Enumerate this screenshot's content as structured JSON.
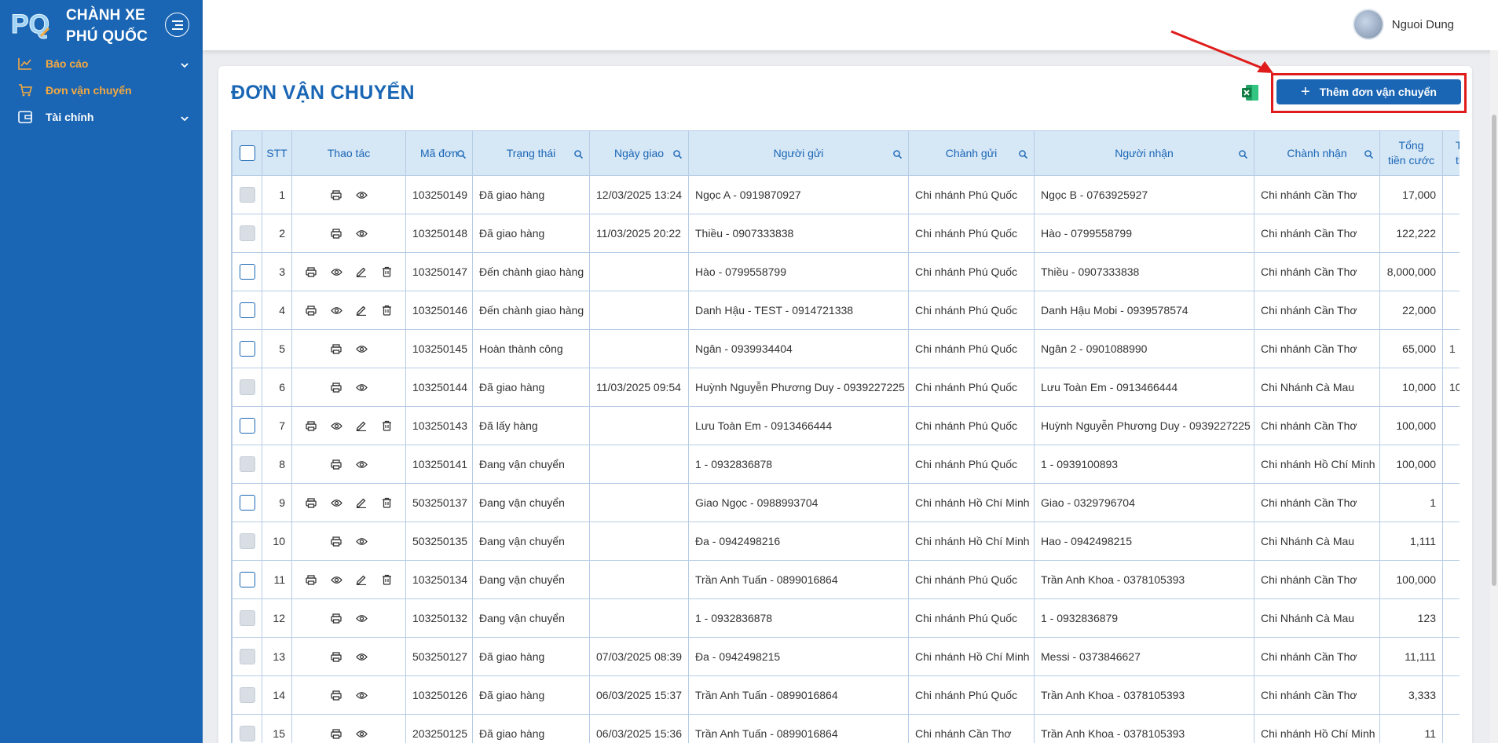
{
  "brand": {
    "line1": "CHÀNH XE",
    "line2": "PHÚ QUỐC",
    "logo_text": "PQ"
  },
  "sidebar": {
    "items": [
      {
        "label": "Báo cáo",
        "icon": "chart-line-icon",
        "has_chevron": true
      },
      {
        "label": "Đơn vận chuyển",
        "icon": "cart-icon",
        "has_chevron": false
      },
      {
        "label": "Tài chính",
        "icon": "wallet-icon",
        "has_chevron": true
      }
    ]
  },
  "user": {
    "name": "Nguoi Dung"
  },
  "page": {
    "title": "ĐƠN VẬN CHUYỂN",
    "add_button": "Thêm đơn vận chuyển"
  },
  "table": {
    "columns": [
      "STT",
      "Thao tác",
      "Mã đơn",
      "Trạng thái",
      "Ngày giao",
      "Người gửi",
      "Chành gửi",
      "Người nhận",
      "Chành nhận",
      "Tổng tiền cước",
      "Tổng thu"
    ],
    "total_fee_lines": [
      "Tổng",
      "tiền cước"
    ],
    "total_collect_lines": [
      "T",
      "th"
    ],
    "rows": [
      {
        "stt": "1",
        "full_actions": false,
        "checkbox_enabled": false,
        "code": "103250149",
        "status": "Đã giao hàng",
        "date": "12/03/2025 13:24",
        "sender": "Ngọc A - 0919870927",
        "from": "Chi nhánh Phú Quốc",
        "receiver": "Ngọc B - 0763925927",
        "to": "Chi nhánh Cần Thơ",
        "fee": "17,000",
        "extra": ""
      },
      {
        "stt": "2",
        "full_actions": false,
        "checkbox_enabled": false,
        "code": "103250148",
        "status": "Đã giao hàng",
        "date": "11/03/2025 20:22",
        "sender": "Thiều - 0907333838",
        "from": "Chi nhánh Phú Quốc",
        "receiver": "Hào - 0799558799",
        "to": "Chi nhánh Cần Thơ",
        "fee": "122,222",
        "extra": ""
      },
      {
        "stt": "3",
        "full_actions": true,
        "checkbox_enabled": true,
        "code": "103250147",
        "status": "Đến chành giao hàng",
        "date": "",
        "sender": "Hào - 0799558799",
        "from": "Chi nhánh Phú Quốc",
        "receiver": "Thiều - 0907333838",
        "to": "Chi nhánh Cần Thơ",
        "fee": "8,000,000",
        "extra": ""
      },
      {
        "stt": "4",
        "full_actions": true,
        "checkbox_enabled": true,
        "code": "103250146",
        "status": "Đến chành giao hàng",
        "date": "",
        "sender": "Danh Hậu - TEST - 0914721338",
        "from": "Chi nhánh Phú Quốc",
        "receiver": "Danh Hậu Mobi - 0939578574",
        "to": "Chi nhánh Cần Thơ",
        "fee": "22,000",
        "extra": ""
      },
      {
        "stt": "5",
        "full_actions": false,
        "checkbox_enabled": true,
        "code": "103250145",
        "status": "Hoàn thành công",
        "date": "",
        "sender": "Ngân - 0939934404",
        "from": "Chi nhánh Phú Quốc",
        "receiver": "Ngân 2 - 0901088990",
        "to": "Chi nhánh Cần Thơ",
        "fee": "65,000",
        "extra": "1"
      },
      {
        "stt": "6",
        "full_actions": false,
        "checkbox_enabled": false,
        "code": "103250144",
        "status": "Đã giao hàng",
        "date": "11/03/2025 09:54",
        "sender": "Huỳnh Nguyễn Phương Duy - 0939227225",
        "from": "Chi nhánh Phú Quốc",
        "receiver": "Lưu Toàn Em - 0913466444",
        "to": "Chi Nhánh Cà Mau",
        "fee": "10,000",
        "extra": "10"
      },
      {
        "stt": "7",
        "full_actions": true,
        "checkbox_enabled": true,
        "code": "103250143",
        "status": "Đã lấy hàng",
        "date": "",
        "sender": "Lưu Toàn Em - 0913466444",
        "from": "Chi nhánh Phú Quốc",
        "receiver": "Huỳnh Nguyễn Phương Duy - 0939227225",
        "to": "Chi nhánh Cần Thơ",
        "fee": "100,000",
        "extra": ""
      },
      {
        "stt": "8",
        "full_actions": false,
        "checkbox_enabled": false,
        "code": "103250141",
        "status": "Đang vận chuyển",
        "date": "",
        "sender": "1 - 0932836878",
        "from": "Chi nhánh Phú Quốc",
        "receiver": "1 - 0939100893",
        "to": "Chi nhánh Hồ Chí Minh",
        "fee": "100,000",
        "extra": ""
      },
      {
        "stt": "9",
        "full_actions": true,
        "checkbox_enabled": true,
        "code": "503250137",
        "status": "Đang vận chuyển",
        "date": "",
        "sender": "Giao Ngọc - 0988993704",
        "from": "Chi nhánh Hồ Chí Minh",
        "receiver": "Giao - 0329796704",
        "to": "Chi nhánh Cần Thơ",
        "fee": "1",
        "extra": ""
      },
      {
        "stt": "10",
        "full_actions": false,
        "checkbox_enabled": false,
        "code": "503250135",
        "status": "Đang vận chuyển",
        "date": "",
        "sender": "Đa - 0942498216",
        "from": "Chi nhánh Hồ Chí Minh",
        "receiver": "Hao - 0942498215",
        "to": "Chi Nhánh Cà Mau",
        "fee": "1,111",
        "extra": ""
      },
      {
        "stt": "11",
        "full_actions": true,
        "checkbox_enabled": true,
        "code": "103250134",
        "status": "Đang vận chuyển",
        "date": "",
        "sender": "Trần Anh Tuấn - 0899016864",
        "from": "Chi nhánh Phú Quốc",
        "receiver": "Trần Anh Khoa - 0378105393",
        "to": "Chi nhánh Cần Thơ",
        "fee": "100,000",
        "extra": ""
      },
      {
        "stt": "12",
        "full_actions": false,
        "checkbox_enabled": false,
        "code": "103250132",
        "status": "Đang vận chuyển",
        "date": "",
        "sender": "1 - 0932836878",
        "from": "Chi nhánh Phú Quốc",
        "receiver": "1 - 0932836879",
        "to": "Chi Nhánh Cà Mau",
        "fee": "123",
        "extra": ""
      },
      {
        "stt": "13",
        "full_actions": false,
        "checkbox_enabled": false,
        "code": "503250127",
        "status": "Đã giao hàng",
        "date": "07/03/2025 08:39",
        "sender": "Đa - 0942498215",
        "from": "Chi nhánh Hồ Chí Minh",
        "receiver": "Messi - 0373846627",
        "to": "Chi nhánh Cần Thơ",
        "fee": "11,111",
        "extra": ""
      },
      {
        "stt": "14",
        "full_actions": false,
        "checkbox_enabled": false,
        "code": "103250126",
        "status": "Đã giao hàng",
        "date": "06/03/2025 15:37",
        "sender": "Trần Anh Tuấn - 0899016864",
        "from": "Chi nhánh Phú Quốc",
        "receiver": "Trần Anh Khoa - 0378105393",
        "to": "Chi nhánh Cần Thơ",
        "fee": "3,333",
        "extra": ""
      },
      {
        "stt": "15",
        "full_actions": false,
        "checkbox_enabled": false,
        "code": "203250125",
        "status": "Đã giao hàng",
        "date": "06/03/2025 15:36",
        "sender": "Trần Anh Tuấn - 0899016864",
        "from": "Chi nhánh Cần Thơ",
        "receiver": "Trần Anh Khoa - 0378105393",
        "to": "Chi nhánh Hồ Chí Minh",
        "fee": "11",
        "extra": ""
      }
    ]
  },
  "colors": {
    "primary": "#1a66b5",
    "accent": "#f5a93f",
    "header_bg": "#d6e7f6",
    "annotation": "#e01b1b"
  }
}
